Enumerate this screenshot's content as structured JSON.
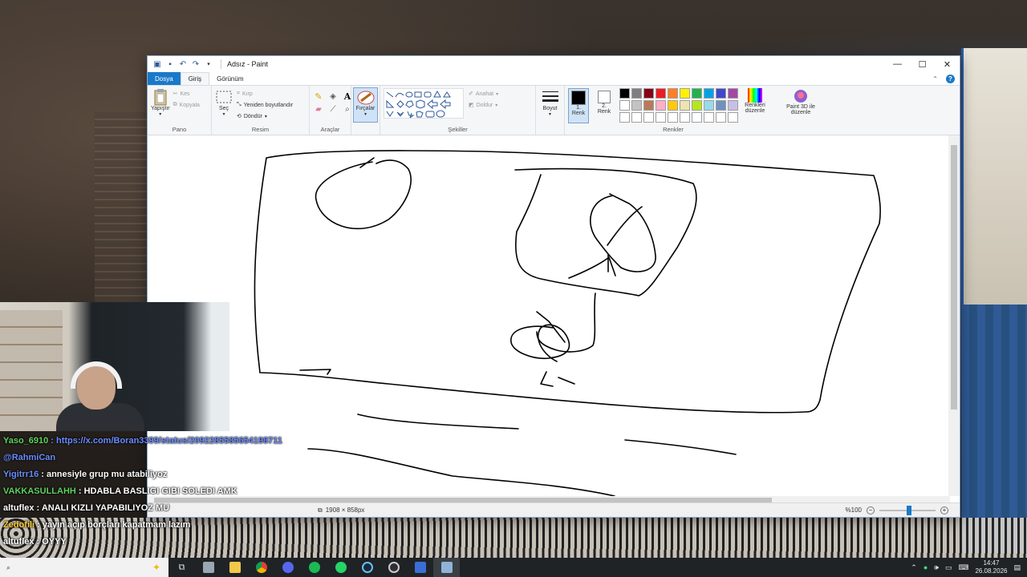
{
  "window": {
    "title": "Adsız - Paint",
    "controls": {
      "minimize": "—",
      "maximize": "☐",
      "close": "✕"
    }
  },
  "tabs": [
    {
      "label": "Dosya"
    },
    {
      "label": "Giriş"
    },
    {
      "label": "Görünüm"
    }
  ],
  "ribbon": {
    "clipboard": {
      "paste": "Yapıştır",
      "cut": "Kes",
      "copy": "Kopyala",
      "label": "Pano"
    },
    "image": {
      "select": "Seç",
      "crop": "Kırp",
      "resize": "Yeniden boyutlandır",
      "rotate": "Döndür",
      "label": "Resim"
    },
    "tools": {
      "label": "Araçlar",
      "text_tool": "A"
    },
    "brushes": {
      "label": "Fırçalar"
    },
    "shapes": {
      "label": "Şekiller",
      "outline": "Anahat",
      "fill": "Doldur"
    },
    "size": {
      "label": "Boyut"
    },
    "colors": {
      "color1": "1. Renk",
      "color2": "2. Renk",
      "edit": "Renkleri düzenle",
      "paint3d": "Paint 3D ile düzenle",
      "label": "Renkler",
      "palette_row1": [
        "#000000",
        "#7f7f7f",
        "#880015",
        "#ed1c24",
        "#ff7f27",
        "#fff200",
        "#22b14c",
        "#00a2e8",
        "#3f48cc",
        "#a349a4"
      ],
      "palette_row2": [
        "#ffffff",
        "#c3c3c3",
        "#b97a57",
        "#ffaec9",
        "#ffc90e",
        "#efe4b0",
        "#b5e61d",
        "#99d9ea",
        "#7092be",
        "#c8bfe7"
      ],
      "palette_row3": [
        "#ffffff",
        "#ffffff",
        "#ffffff",
        "#ffffff",
        "#ffffff",
        "#ffffff",
        "#ffffff",
        "#ffffff",
        "#ffffff",
        "#ffffff"
      ]
    }
  },
  "status": {
    "dimensions": "1908 × 858px",
    "zoom": "%100"
  },
  "chat": [
    {
      "user": "Yaso_6910",
      "user_color": "#5fd35f",
      "text": ": https://x.com/Boran3399/status/2092285585654198711",
      "text_color": "#6a8cff"
    },
    {
      "user": "@RahmiCan",
      "user_color": "#6a8cff",
      "text": "",
      "text_color": "#ffffff"
    },
    {
      "user": "Yigitrr16",
      "user_color": "#6a8cff",
      "text": ": annesiyle grup mu atabiliyoz",
      "text_color": "#ffffff"
    },
    {
      "user": "VAKKASULLAHH",
      "user_color": "#5fd35f",
      "text": ": HDABLA BASLIGI GIBI SOLEDI AMK",
      "text_color": "#ffffff"
    },
    {
      "user": "altuflex",
      "user_color": "#ffffff",
      "text": ": ANALI KIZLI YAPABILIYOZ MU",
      "text_color": "#ffffff"
    },
    {
      "user": "Zedofili",
      "user_color": "#ffcc33",
      "text": ": yayın açıp borçları kapatmam lazım",
      "text_color": "#ffffff"
    },
    {
      "user": "altuflex",
      "user_color": "#ffffff",
      "text": ": OYYY",
      "text_color": "#ffffff"
    }
  ],
  "taskbar": {
    "time": "14:47",
    "date": "26.08.2026"
  },
  "icons": {
    "paste": "clipboard-icon",
    "brush": "brush-icon",
    "help": "?"
  }
}
